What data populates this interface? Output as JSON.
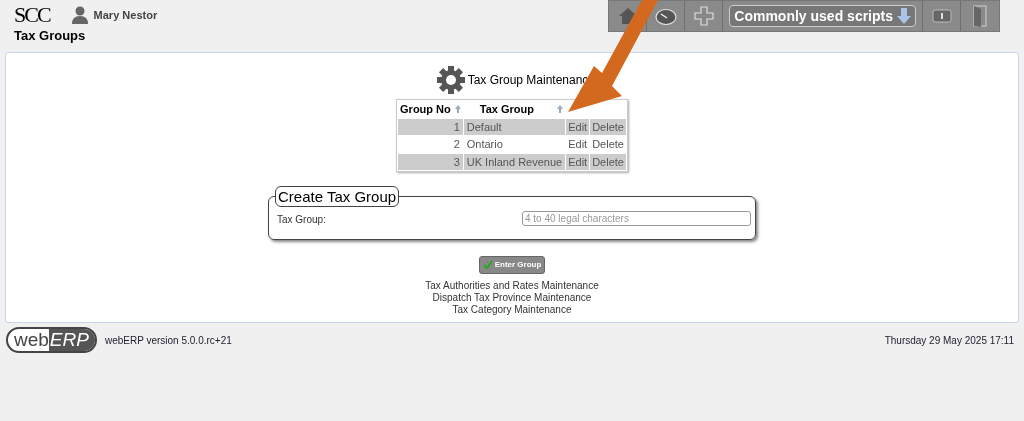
{
  "header": {
    "company_logo": "SCC",
    "user": "Mary Nestor",
    "page_title": "Tax Groups"
  },
  "toolbar": {
    "scripts_menu": "Commonly used scripts"
  },
  "main": {
    "heading": "Tax Group Maintenanc",
    "table": {
      "columns": [
        "Group No",
        "Tax Group"
      ],
      "rows": [
        {
          "group_no": "1",
          "tax_group": "Default",
          "edit": "Edit",
          "delete": "Delete"
        },
        {
          "group_no": "2",
          "tax_group": "Ontario",
          "edit": "Edit",
          "delete": "Delete"
        },
        {
          "group_no": "3",
          "tax_group": "UK Inland Revenue",
          "edit": "Edit",
          "delete": "Delete"
        }
      ]
    },
    "form": {
      "legend": "Create Tax Group",
      "label": "Tax Group:",
      "placeholder": "4 to 40 legal characters"
    },
    "submit": "Enter Group",
    "links": [
      "Tax Authorities and Rates Maintenance",
      "Dispatch Tax Province Maintenance",
      "Tax Category Maintenance"
    ]
  },
  "footer": {
    "logo_left": "web",
    "logo_right": "ERP",
    "version": "webERP version 5.0.0.rc+21",
    "datetime": "Thursday 29 May 2025 17:11"
  }
}
